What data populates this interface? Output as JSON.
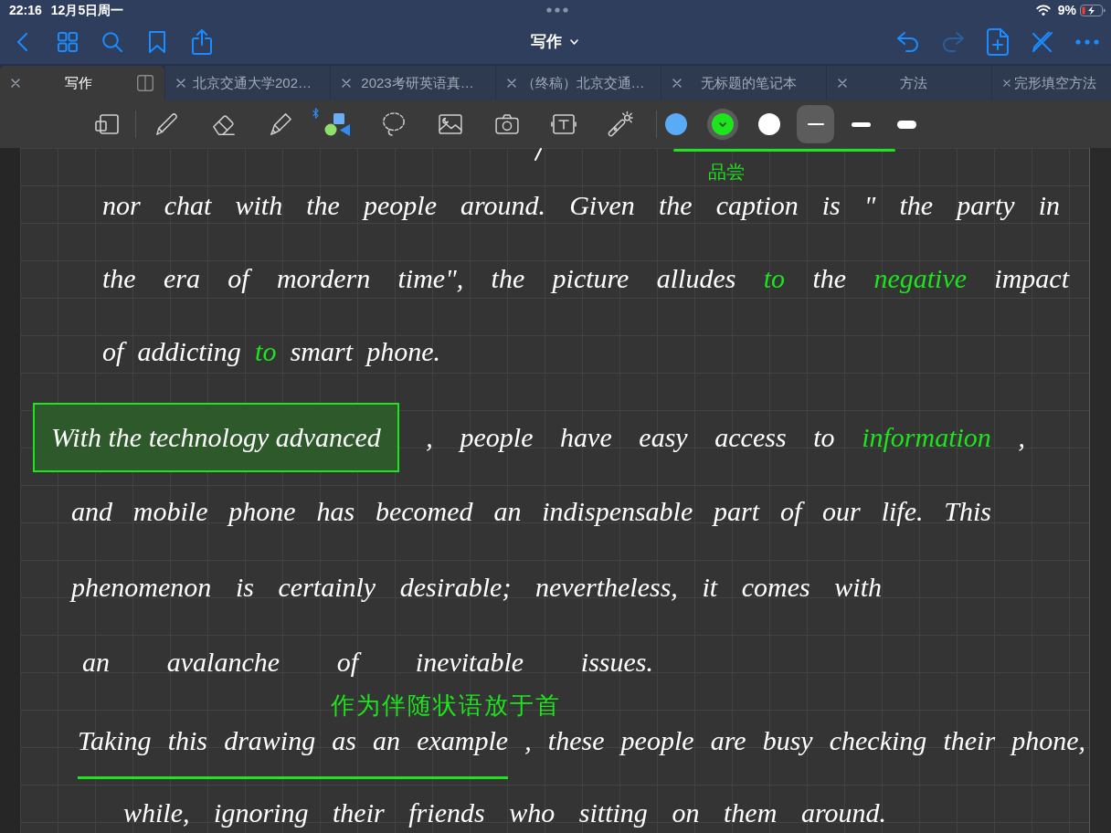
{
  "status_bar": {
    "time": "22:16",
    "date": "12月5日周一",
    "battery": "9%"
  },
  "nav_bar": {
    "title": "写作",
    "actions": [
      {
        "kind": "undo",
        "disabled": false
      },
      {
        "kind": "redo",
        "disabled": true
      }
    ]
  },
  "tabs": [
    {
      "label": "写作",
      "selected": true
    },
    {
      "label": "北京交通大学202…",
      "selected": false
    },
    {
      "label": "2023考研英语真…",
      "selected": false
    },
    {
      "label": "（终稿）北京交通…",
      "selected": false
    },
    {
      "label": "无标题的笔记本",
      "selected": false
    },
    {
      "label": "方法",
      "selected": false
    },
    {
      "label": "完形填空方法",
      "selected": false
    }
  ],
  "toolbar": {
    "colors": [
      {
        "color": "#5aabf5",
        "selected": false
      },
      {
        "color": "#1de41d",
        "selected": true
      },
      {
        "color": "#ffffff",
        "selected": false
      }
    ],
    "stroke_widths": [
      {
        "selected": true
      },
      {
        "selected": false
      },
      {
        "selected": false
      }
    ]
  },
  "page": {
    "items": [
      {
        "kind": "note",
        "text": "品尝",
        "color": "#1de41d"
      },
      {
        "kind": "line",
        "segments": [
          {
            "kind": "plain",
            "text": "nor chat with the people around. Given the caption is \" the party in",
            "color": "#ffffff"
          }
        ]
      },
      {
        "kind": "line",
        "segments": [
          {
            "kind": "plain",
            "text": "the era of mordern time\", the picture alludes",
            "color": "#ffffff"
          },
          {
            "kind": "plain",
            "text": "to",
            "color": "#1de41d"
          },
          {
            "kind": "plain",
            "text": "the",
            "color": "#ffffff"
          },
          {
            "kind": "plain",
            "text": "negative",
            "color": "#1de41d"
          },
          {
            "kind": "plain",
            "text": "impact",
            "color": "#ffffff"
          }
        ]
      },
      {
        "kind": "line",
        "segments": [
          {
            "kind": "plain",
            "text": "of addicting",
            "color": "#ffffff"
          },
          {
            "kind": "plain",
            "text": "to",
            "color": "#1de41d"
          },
          {
            "kind": "plain",
            "text": "smart phone.",
            "color": "#ffffff"
          }
        ]
      },
      {
        "kind": "line",
        "segments": [
          {
            "kind": "boxed",
            "text": "With the technology advanced",
            "color": "#ffffff"
          },
          {
            "kind": "plain",
            "text": ", people have easy access to",
            "color": "#ffffff"
          },
          {
            "kind": "plain",
            "text": "information",
            "color": "#1de41d"
          },
          {
            "kind": "plain",
            "text": ",",
            "color": "#ffffff"
          }
        ]
      },
      {
        "kind": "line",
        "segments": [
          {
            "kind": "plain",
            "text": "and mobile phone has becomed an indispensable part of our life. This",
            "color": "#ffffff"
          }
        ]
      },
      {
        "kind": "line",
        "segments": [
          {
            "kind": "plain",
            "text": "phenomenon is certainly desirable; nevertheless, it comes with",
            "color": "#ffffff"
          }
        ]
      },
      {
        "kind": "line",
        "segments": [
          {
            "kind": "plain",
            "text": "an avalanche of inevitable issues.",
            "color": "#ffffff"
          }
        ]
      },
      {
        "kind": "note",
        "text": "作为伴随状语放于首",
        "color": "#1de41d"
      },
      {
        "kind": "line",
        "segments": [
          {
            "kind": "underlined",
            "text": "Taking this drawing as an example",
            "color": "#ffffff"
          },
          {
            "kind": "plain",
            "text": ", these people are busy checking their phone,",
            "color": "#ffffff"
          }
        ]
      },
      {
        "kind": "line",
        "segments": [
          {
            "kind": "plain",
            "text": "while, ignoring their friends who sitting on them around.",
            "color": "#ffffff"
          }
        ]
      }
    ]
  }
}
